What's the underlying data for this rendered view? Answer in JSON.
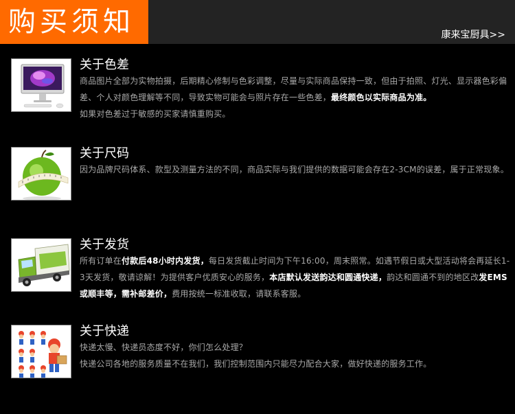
{
  "header": {
    "title": "购买须知",
    "link": "康来宝厨具>>"
  },
  "sections": [
    {
      "title": "关于色差",
      "icon": "computer-monitor-icon",
      "lines": [
        [
          "商品图片全部为实物拍摄，后期精心修制与色彩调整，尽量与实际商品保持一致，但由于拍照、灯光、显示器色彩偏差、个人对颜色理解等不同，导致实物可能会与照片存在一些色差，",
          "最终颜色以实际商品为准。"
        ],
        [
          "如果对色差过于敏感的买家请慎重购买。"
        ]
      ]
    },
    {
      "title": "关于尺码",
      "icon": "apple-measuring-tape-icon",
      "lines": [
        [
          "因为品牌尺码体系、款型及测量方法的不同，商品实际与我们提供的数据可能会存在2-3CM的误差，属于正常现象。"
        ]
      ]
    },
    {
      "title": "关于发货",
      "icon": "delivery-truck-icon",
      "segments": [
        {
          "t": "所有订单在",
          "b": false
        },
        {
          "t": "付款后48小时内发货，",
          "b": true
        },
        {
          "t": "每日发货截止时间为下午16:00，周末照常。如遇节假日或大型活动将会再延长1-3天发货，敬请谅解！为提供客户优质安心的服务，",
          "b": false
        },
        {
          "t": "本店默认发送韵达和圆通快递，",
          "b": true
        },
        {
          "t": "韵达和圆通不到的地区改",
          "b": false
        },
        {
          "t": "发EMS或顺丰等，需补邮差价，",
          "b": true
        },
        {
          "t": "费用按统一标准收取，请联系客服。",
          "b": false
        }
      ]
    },
    {
      "title": "关于快递",
      "icon": "courier-figures-icon",
      "lines": [
        [
          "快递太慢、快递员态度不好，你们怎么处理？"
        ],
        [
          "快递公司各地的服务质量不在我们，我们控制范围内只能尽力配合大家，做好快递的服务工作。"
        ]
      ]
    }
  ]
}
